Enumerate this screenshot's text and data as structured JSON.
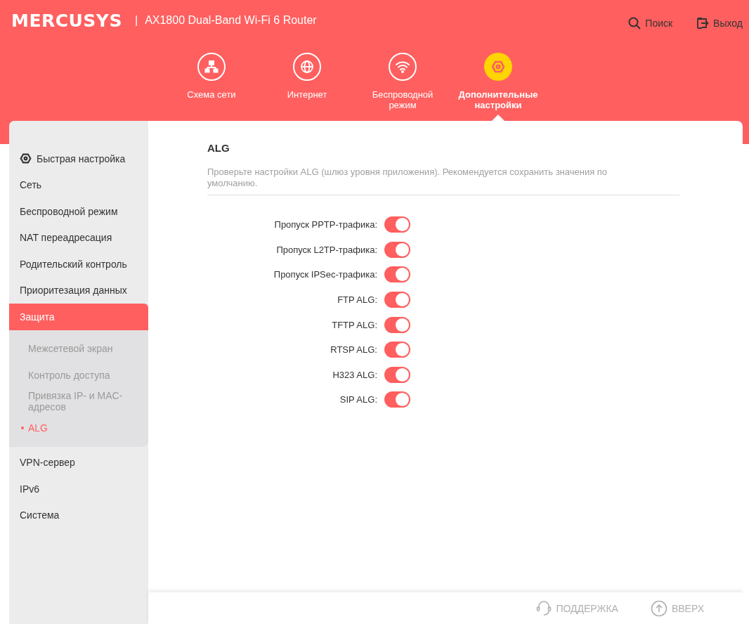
{
  "header": {
    "logo": "MERCUSYS",
    "separator": "|",
    "model": "AX1800 Dual-Band Wi-Fi 6 Router",
    "actions": [
      {
        "kind": "search",
        "label": "Поиск"
      },
      {
        "kind": "logout",
        "label": "Выход"
      }
    ]
  },
  "nav": [
    {
      "kind": "network",
      "label": "Схема сети",
      "selected": false
    },
    {
      "kind": "internet",
      "label": "Интернет",
      "selected": false
    },
    {
      "kind": "wireless",
      "label": "Беспроводной режим",
      "selected": false
    },
    {
      "kind": "advanced",
      "label": "Дополнительные настройки",
      "selected": true
    }
  ],
  "sidebar": {
    "items": [
      {
        "kind": "quick",
        "label": "Быстрая настройка",
        "selected": false
      },
      {
        "kind": "link",
        "label": "Сеть",
        "selected": false
      },
      {
        "kind": "link",
        "label": "Беспроводной режим",
        "selected": false
      },
      {
        "kind": "link",
        "label": "NAT переадресация",
        "selected": false
      },
      {
        "kind": "link",
        "label": "Родительский контроль",
        "selected": false
      },
      {
        "kind": "link",
        "label": "Приоритезация данных",
        "selected": false
      },
      {
        "kind": "link",
        "label": "Защита",
        "selected": true,
        "expanded": true,
        "children": [
          {
            "label": "Межсетевой экран",
            "selected": false
          },
          {
            "label": "Контроль доступа",
            "selected": false
          },
          {
            "label": "Привязка IP- и MAC-адресов",
            "selected": false
          },
          {
            "label": "ALG",
            "selected": true
          }
        ]
      },
      {
        "kind": "link",
        "label": "VPN-сервер",
        "selected": false
      },
      {
        "kind": "link",
        "label": "IPv6",
        "selected": false
      },
      {
        "kind": "link",
        "label": "Система",
        "selected": false
      }
    ]
  },
  "content": {
    "title": "ALG",
    "description": "Проверьте настройки ALG (шлюз уровня приложения). Рекомендуется сохранить значения по умолчанию.",
    "toggles": [
      {
        "label": "Пропуск PPTP-трафика:",
        "on": true
      },
      {
        "label": "Пропуск L2TP-трафика:",
        "on": true
      },
      {
        "label": "Пропуск IPSec-трафика:",
        "on": true
      },
      {
        "label": "FTP ALG:",
        "on": true
      },
      {
        "label": "TFTP ALG:",
        "on": true
      },
      {
        "label": "RTSP ALG:",
        "on": true
      },
      {
        "label": "H323 ALG:",
        "on": true
      },
      {
        "label": "SIP ALG:",
        "on": true
      }
    ]
  },
  "footer": [
    {
      "kind": "support",
      "label": "ПОДДЕРЖКА"
    },
    {
      "kind": "up",
      "label": "ВВЕРХ"
    }
  ]
}
